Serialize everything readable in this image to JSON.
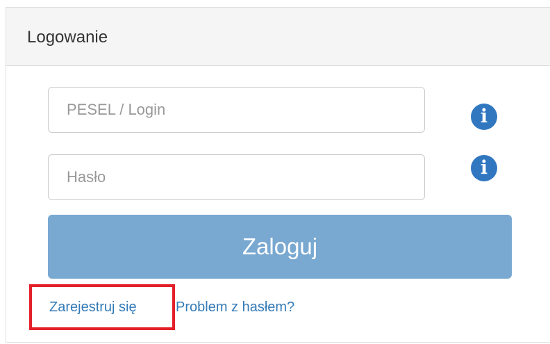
{
  "panel": {
    "title": "Logowanie"
  },
  "form": {
    "login": {
      "placeholder": "PESEL / Login",
      "value": "",
      "info_icon": "info-circle-icon"
    },
    "password": {
      "placeholder": "Hasło",
      "value": "",
      "info_icon": "info-circle-icon"
    },
    "submit_label": "Zaloguj"
  },
  "links": {
    "register": "Zarejestruj się",
    "forgot_password": "Problem z hasłem?"
  },
  "colors": {
    "accent": "#3177c0",
    "button": "#79a8d1",
    "link": "#337ab7",
    "highlight": "#e3202a"
  }
}
